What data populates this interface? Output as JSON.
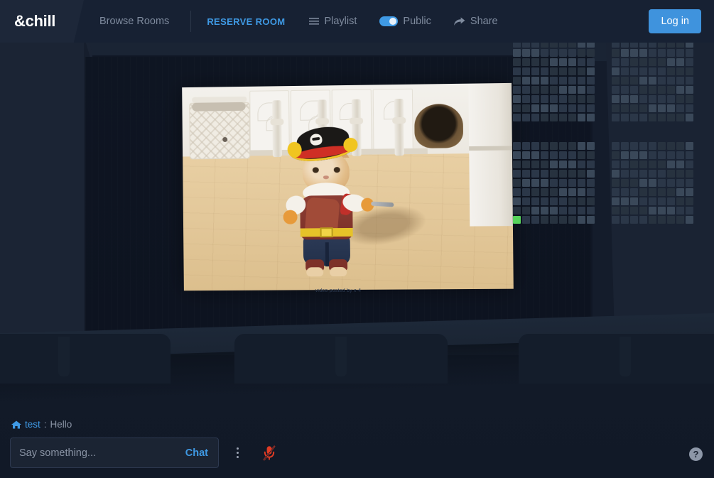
{
  "app": {
    "logo": "&chill",
    "accent_blue": "#3f9ae5",
    "login_blue": "#3f93dd",
    "bg_dark": "#141c2b",
    "bar_bg": "#172133",
    "seat_taken_green": "#57d35b",
    "mic_muted_red": "#e03b24"
  },
  "topbar": {
    "browse_label": "Browse Rooms",
    "reserve_label": "RESERVE ROOM",
    "playlist_label": "Playlist",
    "playlist_icon": "hamburger-icon",
    "public_label": "Public",
    "public_toggle_on": true,
    "share_label": "Share",
    "share_icon": "share-arrow-icon",
    "login_label": "Log in"
  },
  "stage": {
    "video_caption": "video posted by x-4",
    "video_alt": "cat in pirate costume standing on wooden floor"
  },
  "seatmap": {
    "blocks": [
      {
        "id": "left-upper",
        "rows": 9,
        "cols": 9
      },
      {
        "id": "right-upper",
        "rows": 9,
        "cols": 9
      },
      {
        "id": "left-lower",
        "rows": 9,
        "cols": 9
      },
      {
        "id": "right-lower",
        "rows": 9,
        "cols": 9
      }
    ],
    "occupied_seat": {
      "block": "left-lower",
      "row": 9,
      "col": 1
    }
  },
  "chat": {
    "messages": [
      {
        "icon": "home-icon",
        "user": "test",
        "separator": ":",
        "text": "Hello"
      }
    ],
    "input_value": "",
    "input_placeholder": "Say something...",
    "send_label": "Chat",
    "menu_icon": "vertical-dots-icon",
    "mic_icon": "microphone-muted-icon",
    "help_label": "?"
  }
}
